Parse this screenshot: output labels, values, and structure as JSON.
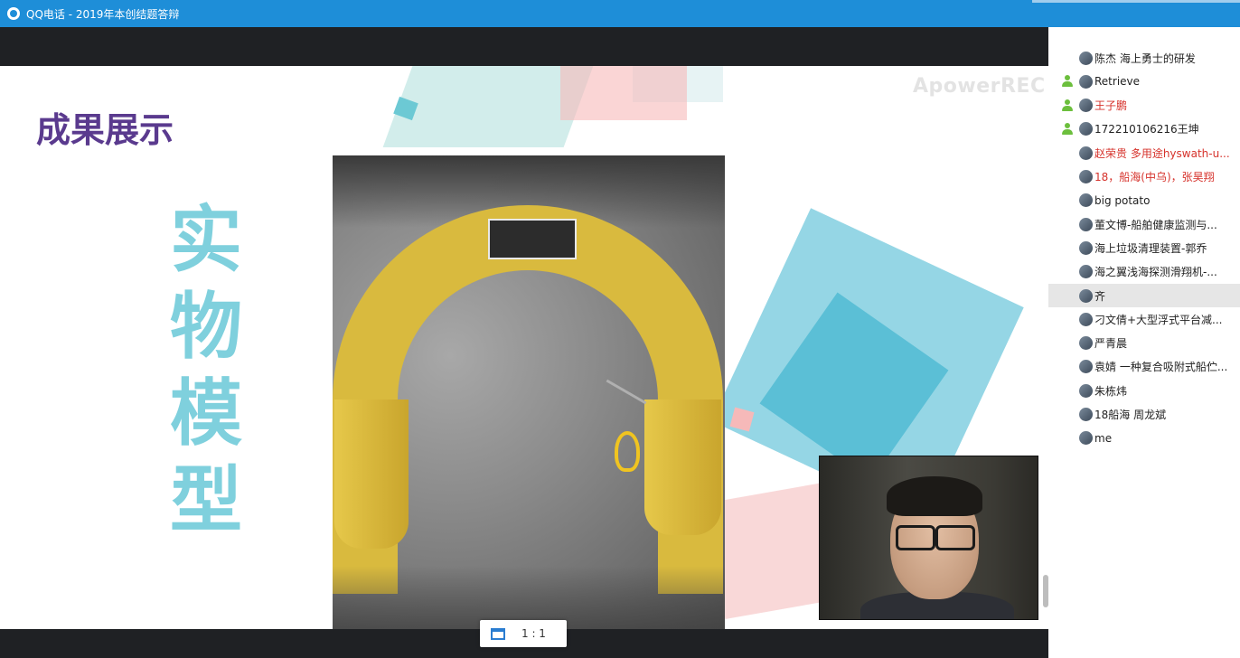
{
  "window": {
    "title": "QQ电话 - 2019年本创结题答辩"
  },
  "slide": {
    "title": "成果展示",
    "vertical_text": [
      "实",
      "物",
      "模",
      "型"
    ],
    "watermark": "ApowerREC"
  },
  "controls": {
    "ratio_label": "1 : 1"
  },
  "participants": [
    {
      "name": "陈杰 海上勇士的研发",
      "host": false,
      "highlight": false,
      "active": false
    },
    {
      "name": "Retrieve",
      "host": true,
      "highlight": false,
      "active": false
    },
    {
      "name": "王子鹏",
      "host": true,
      "highlight": true,
      "active": false
    },
    {
      "name": "172210106216王坤",
      "host": true,
      "highlight": false,
      "active": false
    },
    {
      "name": "赵荣贵 多用途hyswath-u...",
      "host": false,
      "highlight": true,
      "active": false
    },
    {
      "name": "18，船海(中乌)，张昊翔",
      "host": false,
      "highlight": true,
      "active": false
    },
    {
      "name": "big potato",
      "host": false,
      "highlight": false,
      "active": false
    },
    {
      "name": "董文博-船舶健康监测与...",
      "host": false,
      "highlight": false,
      "active": false
    },
    {
      "name": "海上垃圾清理装置-郭乔",
      "host": false,
      "highlight": false,
      "active": false
    },
    {
      "name": "海之翼浅海探测滑翔机-...",
      "host": false,
      "highlight": false,
      "active": false
    },
    {
      "name": "齐",
      "host": false,
      "highlight": false,
      "active": true
    },
    {
      "name": "刁文倩+大型浮式平台减...",
      "host": false,
      "highlight": false,
      "active": false
    },
    {
      "name": "严青晨",
      "host": false,
      "highlight": false,
      "active": false
    },
    {
      "name": "袁婧 一种复合吸附式船伫...",
      "host": false,
      "highlight": false,
      "active": false
    },
    {
      "name": "朱栋炜",
      "host": false,
      "highlight": false,
      "active": false
    },
    {
      "name": "18船海 周龙斌",
      "host": false,
      "highlight": false,
      "active": false
    },
    {
      "name": "me",
      "host": false,
      "highlight": false,
      "active": false
    }
  ]
}
